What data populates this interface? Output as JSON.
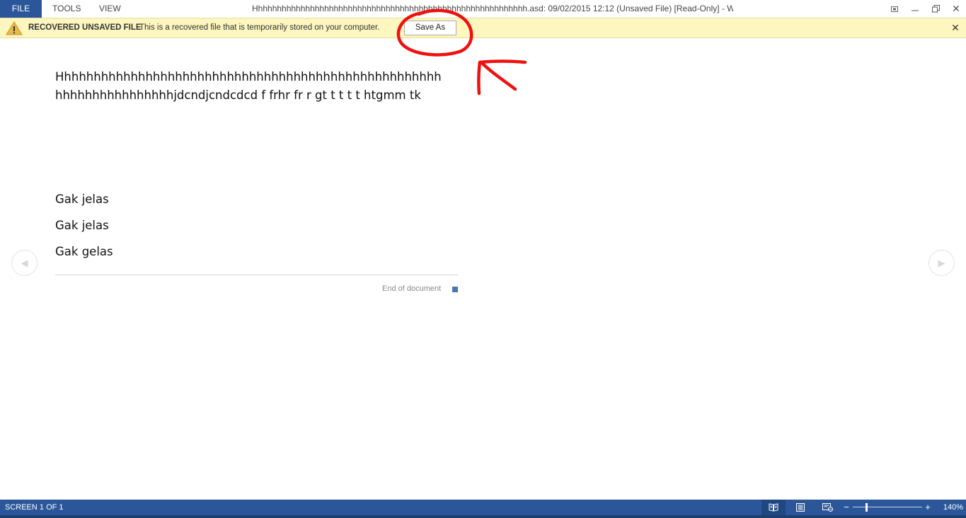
{
  "titlebar": {
    "menu": {
      "file": "FILE",
      "tools": "TOOLS",
      "view": "VIEW"
    },
    "window_title": "Hhhhhhhhhhhhhhhhhhhhhhhhhhhhhhhhhhhhhhhhhhhhhhhhhhhhhhhhhh.asd: 09/02/2015 12:12 (Unsaved File) [Read-Only] - Word",
    "buttons": {
      "fullscreen": "⛶",
      "minimize": "—",
      "restore": "❐",
      "close": "✕"
    }
  },
  "message_bar": {
    "title": "RECOVERED UNSAVED FILE",
    "text": "This is a recovered file that is temporarily stored on your computer.",
    "button_label": "Save As",
    "close": "✕",
    "background_color": "#fdf6bf"
  },
  "document": {
    "lines": [
      "Hhhhhhhhhhhhhhhhhhhhhhhhhhhhhhhhhhhhhhhhhhhhhhhhhhhh",
      "hhhhhhhhhhhhhhhhjdcndjcndcdcd f frhr fr r gt t t t t htgmm tk"
    ],
    "paragraphs": [
      "Gak jelas",
      "Gak jelas",
      "Gak gelas"
    ],
    "end_text": "End of document"
  },
  "navigation": {
    "prev": "◀",
    "next": "▶"
  },
  "annotation": {
    "color": "#ee1111",
    "shapes": [
      "circle around Save As button",
      "arrow pointing to Save As button"
    ]
  },
  "status_bar": {
    "screen": "SCREEN 1 OF 1",
    "zoom_out": "−",
    "zoom_in": "+",
    "zoom_level": "140%",
    "zoom_fraction": 0.2,
    "background_color": "#2b579a"
  }
}
